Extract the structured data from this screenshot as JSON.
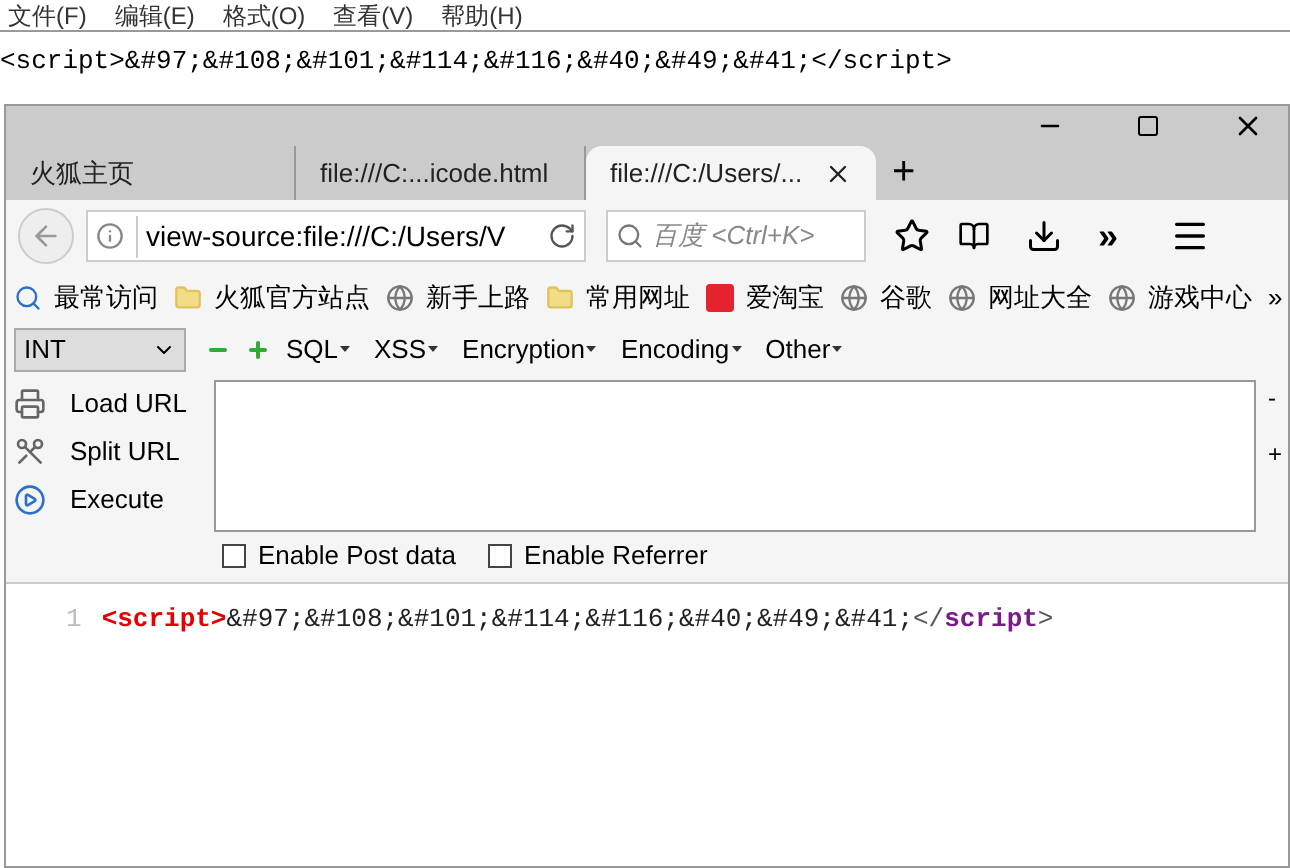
{
  "notepad": {
    "menu": [
      "文件(F)",
      "编辑(E)",
      "格式(O)",
      "查看(V)",
      "帮助(H)"
    ],
    "text": "<script>&#97;&#108;&#101;&#114;&#116;&#40;&#49;&#41;</script>"
  },
  "browser": {
    "tabs": [
      {
        "label": "火狐主页",
        "selected": false
      },
      {
        "label": "file:///C:...icode.html",
        "selected": false
      },
      {
        "label": "file:///C:/Users/...",
        "selected": true
      }
    ],
    "new_tab": "+",
    "address": {
      "value": "view-source:file:///C:/Users/V"
    },
    "search": {
      "placeholder": "百度 <Ctrl+K>"
    },
    "overflow": "»",
    "bookmarks": [
      {
        "kind": "search",
        "label": "最常访问"
      },
      {
        "kind": "folder",
        "label": "火狐官方站点"
      },
      {
        "kind": "globe",
        "label": "新手上路"
      },
      {
        "kind": "folder",
        "label": "常用网址"
      },
      {
        "kind": "shop",
        "label": "爱淘宝"
      },
      {
        "kind": "globe",
        "label": "谷歌"
      },
      {
        "kind": "globe",
        "label": "网址大全"
      },
      {
        "kind": "globe",
        "label": "游戏中心"
      }
    ],
    "bookmarks_overflow": "»"
  },
  "hackbar": {
    "select": "INT",
    "menus": [
      "SQL",
      "XSS",
      "Encryption",
      "Encoding",
      "Other"
    ],
    "actions": [
      {
        "kind": "load",
        "label": "Load URL"
      },
      {
        "kind": "split",
        "label": "Split URL"
      },
      {
        "kind": "execute",
        "label": "Execute"
      }
    ],
    "side_marks": [
      "-",
      "+"
    ],
    "options": [
      {
        "label": "Enable Post data",
        "checked": false
      },
      {
        "label": "Enable Referrer",
        "checked": false
      }
    ]
  },
  "source": {
    "line_number": "1",
    "tokens": [
      {
        "kind": "tag",
        "text": "<script>"
      },
      {
        "kind": "plain",
        "text": "&#97;&#108;&#101;&#114;&#116;&#40;&#49;&#41;"
      },
      {
        "kind": "punct",
        "text": "</"
      },
      {
        "kind": "endtag",
        "text": "script"
      },
      {
        "kind": "punct",
        "text": ">"
      }
    ]
  }
}
